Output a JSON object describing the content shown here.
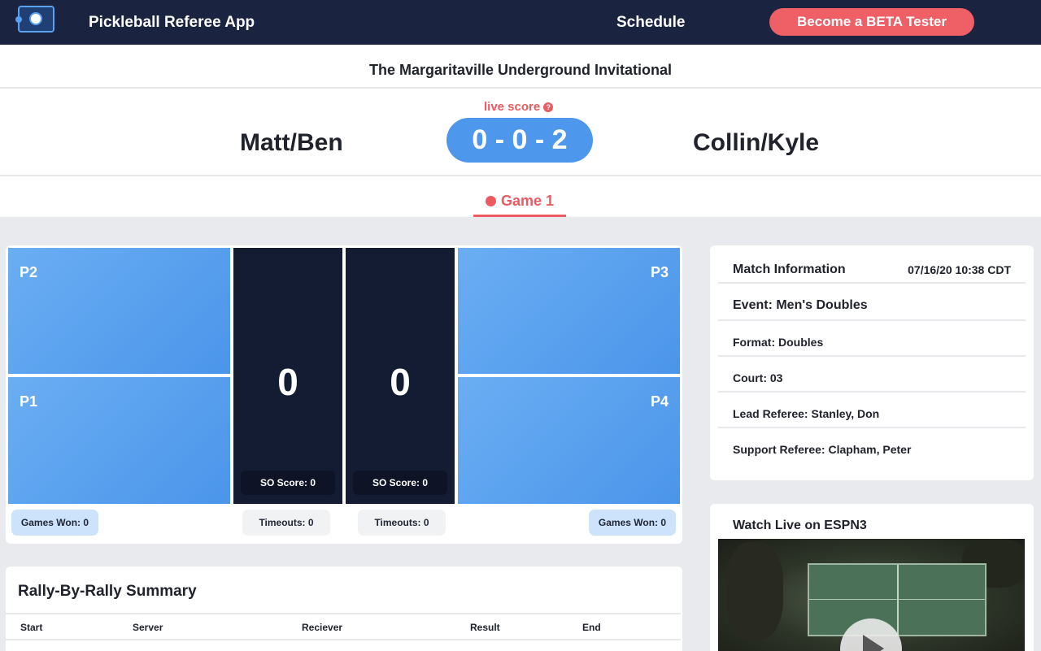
{
  "header": {
    "app_title": "Pickleball Referee App",
    "schedule_label": "Schedule",
    "beta_button": "Become a BETA Tester",
    "logo_icon": "pickleball-logo-icon"
  },
  "event": {
    "title": "The Margaritaville Underground Invitational"
  },
  "scoreboard": {
    "live_label": "live score",
    "help_icon": "question-circle-icon",
    "help_glyph": "?",
    "team_left": "Matt/Ben",
    "score": "0 - 0 - 2",
    "team_right": "Collin/Kyle"
  },
  "game_tab": {
    "label": "Game 1",
    "dot_icon": "live-dot-icon"
  },
  "court": {
    "players": {
      "p1": "P1",
      "p2": "P2",
      "p3": "P3",
      "p4": "P4"
    },
    "left": {
      "score": "0",
      "so_score": "SO Score: 0",
      "games_won": "Games Won: 0",
      "timeouts": "Timeouts: 0"
    },
    "right": {
      "score": "0",
      "so_score": "SO Score: 0",
      "games_won": "Games Won: 0",
      "timeouts": "Timeouts: 0"
    }
  },
  "rally": {
    "title": "Rally-By-Rally Summary",
    "columns": [
      "Start",
      "Server",
      "Reciever",
      "Result",
      "End"
    ]
  },
  "match_info": {
    "title": "Match Information",
    "timestamp": "07/16/20 10:38 CDT",
    "event": "Event: Men's Doubles",
    "format": "Format: Doubles",
    "court": "Court: 03",
    "lead_referee": "Lead Referee: Stanley, Don",
    "support_referee": "Support Referee: Clapham, Peter"
  },
  "watch": {
    "title": "Watch Live on ESPN3",
    "play_icon": "play-icon"
  },
  "colors": {
    "navbar": "#1a2340",
    "accent_red": "#ec5a62",
    "score_blue": "#4d98ec",
    "player_blue": "#5aa2f0",
    "score_column": "#141c33"
  }
}
